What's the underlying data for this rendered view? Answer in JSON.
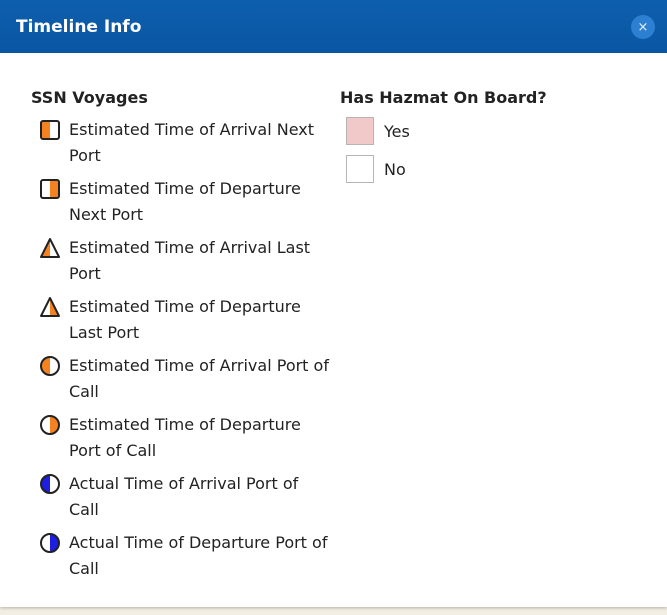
{
  "dialog": {
    "title": "Timeline Info",
    "close_label": "×"
  },
  "legend": {
    "heading": "SSN Voyages",
    "items": [
      {
        "label": "Estimated Time of Arrival Next Port",
        "icon": "half-square-left-orange-icon"
      },
      {
        "label": "Estimated Time of Departure Next Port",
        "icon": "half-square-right-orange-icon"
      },
      {
        "label": "Estimated Time of Arrival Last Port",
        "icon": "half-triangle-left-orange-icon"
      },
      {
        "label": "Estimated Time of Departure Last Port",
        "icon": "half-triangle-right-orange-icon"
      },
      {
        "label": "Estimated Time of Arrival Port of Call",
        "icon": "half-circle-left-orange-icon"
      },
      {
        "label": "Estimated Time of Departure Port of Call",
        "icon": "half-circle-right-orange-icon"
      },
      {
        "label": "Actual Time of Arrival Port of Call",
        "icon": "half-circle-left-blue-icon"
      },
      {
        "label": "Actual Time of Departure Port of Call",
        "icon": "half-circle-right-blue-icon"
      }
    ]
  },
  "hazmat": {
    "heading": "Has Hazmat On Board?",
    "options": [
      {
        "label": "Yes",
        "color": "#f2c9c9"
      },
      {
        "label": "No",
        "color": "#ffffff"
      }
    ]
  },
  "colors": {
    "titlebar": "#0a56a3",
    "orange": "#f58220",
    "blue": "#1e1ee0"
  }
}
